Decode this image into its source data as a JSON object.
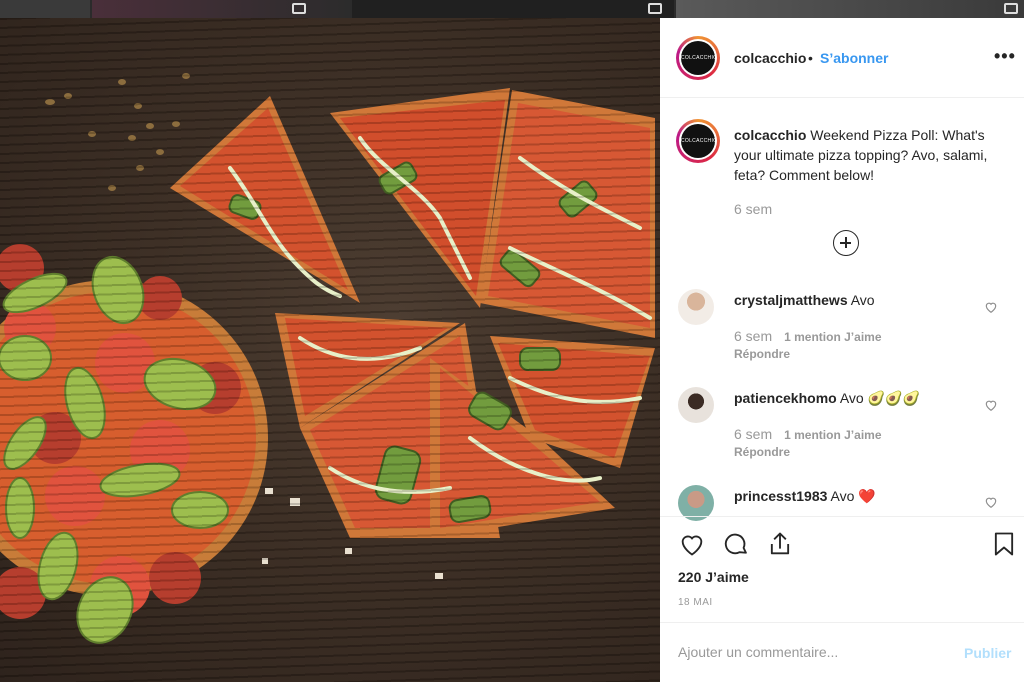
{
  "post": {
    "username": "colcacchio",
    "dot": "•",
    "follow_label": "S’abonner",
    "more_label": "•••",
    "avatar_text": "COLCACCHIO",
    "caption_user": "colcacchio",
    "caption_text": " Weekend Pizza Poll: What's your ultimate pizza topping? Avo, salami, feta? Comment below!",
    "caption_time": "6 sem",
    "likes": "220 J’aime",
    "date": "18 MAI"
  },
  "comments": [
    {
      "user": "crystaljmatthews",
      "text": " Avo",
      "time": "6 sem",
      "likes": "1 mention J’aime",
      "reply": "Répondre"
    },
    {
      "user": "patiencekhomo",
      "text": " Avo 🥑🥑🥑",
      "time": "6 sem",
      "likes": "1 mention J’aime",
      "reply": "Répondre"
    },
    {
      "user": "princesst1983",
      "text": " Avo ❤️"
    }
  ],
  "add_comment": {
    "placeholder": "Ajouter un commentaire...",
    "publish_label": "Publier"
  },
  "icons": {
    "like": "heart-icon",
    "comment": "comment-icon",
    "share": "share-icon",
    "save": "bookmark-icon",
    "comment_like": "heart-icon"
  },
  "colors": {
    "link": "#3897f0",
    "publish_disabled": "#b2dffc",
    "muted": "#999999"
  }
}
